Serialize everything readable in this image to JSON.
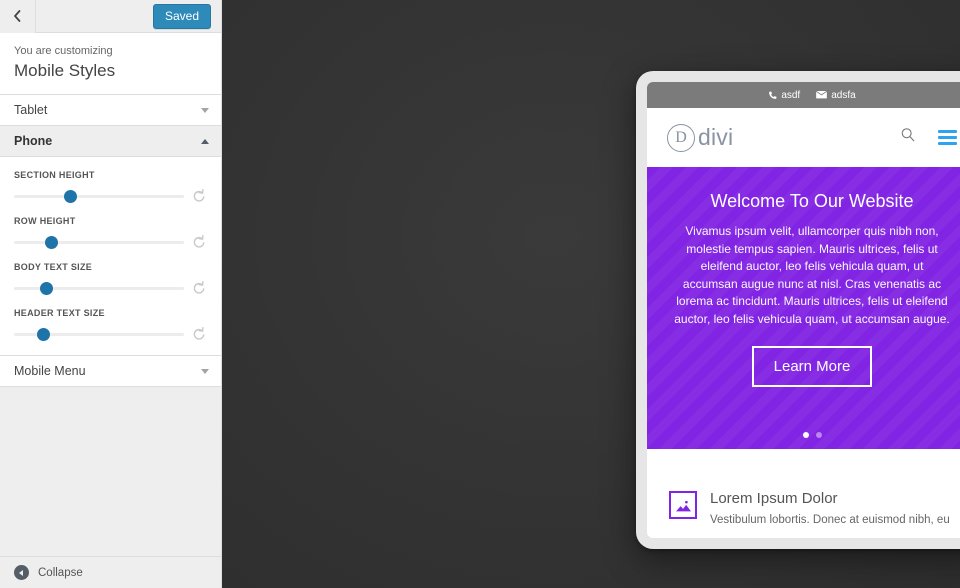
{
  "customizer": {
    "back_icon": "chevron-left-icon",
    "save_button": "Saved",
    "eyebrow": "You are customizing",
    "title": "Mobile Styles",
    "accordions": [
      {
        "label": "Tablet",
        "state": "collapsed",
        "chevron": "chevron-down-icon"
      },
      {
        "label": "Phone",
        "state": "expanded",
        "chevron": "chevron-up-icon"
      }
    ],
    "controls": [
      {
        "label": "SECTION HEIGHT",
        "value_pct": 33,
        "reset_icon": "reset-arrow-icon"
      },
      {
        "label": "ROW HEIGHT",
        "value_pct": 22,
        "reset_icon": "reset-arrow-icon"
      },
      {
        "label": "BODY TEXT SIZE",
        "value_pct": 19,
        "reset_icon": "reset-arrow-icon"
      },
      {
        "label": "HEADER TEXT SIZE",
        "value_pct": 17,
        "reset_icon": "reset-arrow-icon"
      }
    ],
    "mobile_menu": {
      "label": "Mobile Menu",
      "chevron": "chevron-down-icon"
    },
    "collapse": {
      "label": "Collapse",
      "icon": "collapse-arrow-icon"
    }
  },
  "preview": {
    "device": "phone",
    "topbar": {
      "phone_icon": "phone-icon",
      "phone_text": "asdf",
      "email_icon": "envelope-icon",
      "email_text": "adsfa"
    },
    "nav": {
      "logo_mark": "D",
      "logo_text": "divi",
      "search_icon": "search-icon",
      "menu_icon": "hamburger-menu-icon"
    },
    "hero": {
      "title": "Welcome To Our Website",
      "body": "Vivamus ipsum velit, ullamcorper quis nibh non, molestie tempus sapien. Mauris ultrices, felis ut eleifend auctor, leo felis vehicula quam, ut accumsan augue nunc at nisl. Cras venenatis ac lorema ac tincidunt. Mauris ultrices, felis ut eleifend auctor, leo felis vehicula quam, ut accumsan augue.",
      "button": "Learn More",
      "dots": [
        "active",
        "idle"
      ]
    },
    "blurb": {
      "icon": "image-placeholder-icon",
      "title": "Lorem Ipsum Dolor",
      "text": "Vestibulum lobortis. Donec at euismod nibh, eu"
    }
  },
  "colors": {
    "accent_blue": "#2ea3f2",
    "save_blue": "#2e8ab8",
    "slider_blue": "#1e73a8",
    "hero_purple": "#8224e3",
    "backdrop": "#333333",
    "topbar_gray": "#7b7b7b"
  }
}
